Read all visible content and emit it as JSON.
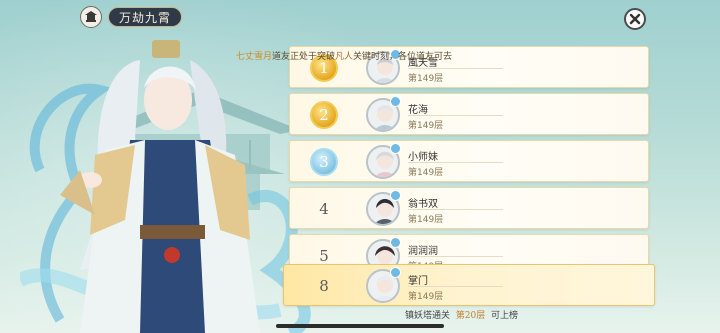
{
  "header": {
    "title": "万劫九霄",
    "menu_icon": "pavilion-icon",
    "close_icon": "close-icon"
  },
  "marquee": {
    "name1": "七丈雪月",
    "text1": "道友正处于突破",
    "realm": "凡人",
    "text2": "关键时刻，各位道友可去"
  },
  "ranking": [
    {
      "rank": "1",
      "name": "風天雪",
      "floor": "第149层",
      "rank_style": "gold"
    },
    {
      "rank": "2",
      "name": "花海",
      "floor": "第149层",
      "rank_style": "gold"
    },
    {
      "rank": "3",
      "name": "小师妹",
      "floor": "第149层",
      "rank_style": "blue"
    },
    {
      "rank": "4",
      "name": "翁书双",
      "floor": "第149层",
      "rank_style": "plain"
    },
    {
      "rank": "5",
      "name": "润润润",
      "floor": "第149层",
      "rank_style": "plain"
    }
  ],
  "my_entry": {
    "rank": "8",
    "name": "掌门",
    "floor": "第149层"
  },
  "footer": {
    "prefix": "镇妖塔通关",
    "floor": "第20层",
    "suffix": "可上榜"
  },
  "colors": {
    "gold": "#e5a821",
    "highlight_row": "#ffe7a3",
    "title_bg": "#2f3a48"
  }
}
